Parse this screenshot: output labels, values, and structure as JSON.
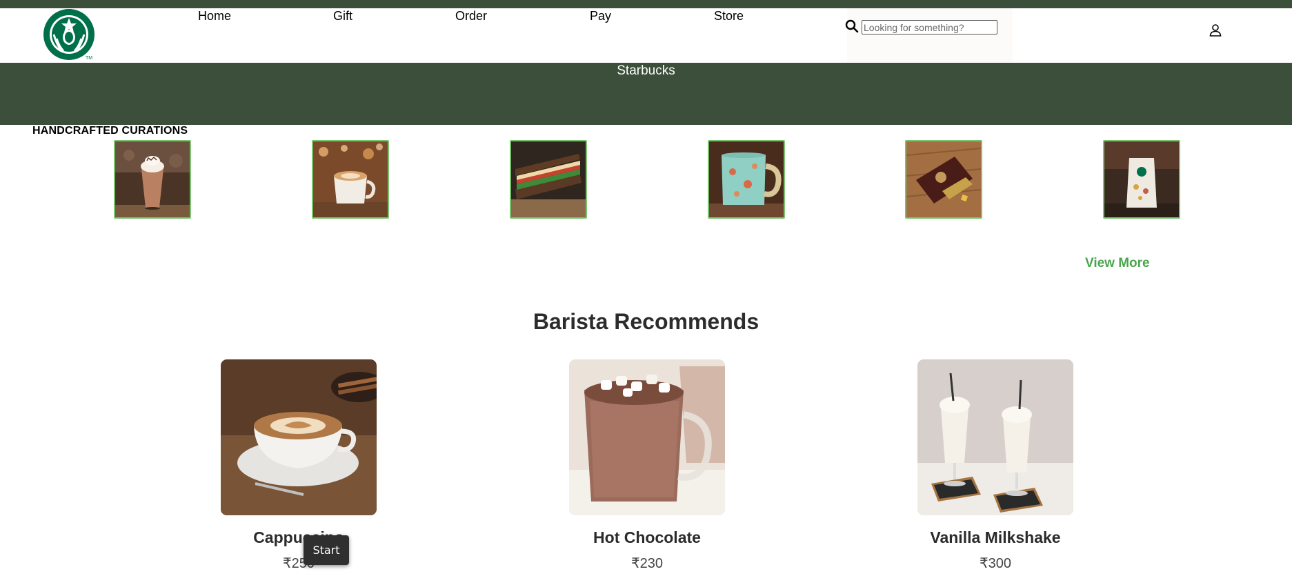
{
  "nav": {
    "items": [
      {
        "label": "Home"
      },
      {
        "label": "Gift"
      },
      {
        "label": "Order"
      },
      {
        "label": "Pay"
      },
      {
        "label": "Store"
      }
    ]
  },
  "search": {
    "placeholder": "Looking for something?",
    "value": ""
  },
  "icons": {
    "logo": "starbucks-siren-logo",
    "search": "search-icon",
    "user": "user-icon"
  },
  "banner": {
    "title": "Starbucks"
  },
  "curations": {
    "title": "HANDCRAFTED CURATIONS",
    "items": [
      {
        "image": "frappuccino-glass"
      },
      {
        "image": "latte-mug"
      },
      {
        "image": "sandwich"
      },
      {
        "image": "teal-mug"
      },
      {
        "image": "chocolate-box"
      },
      {
        "image": "coffee-bean-bag"
      }
    ],
    "view_more_label": "View More"
  },
  "barista": {
    "title": "Barista Recommends",
    "items": [
      {
        "name": "Cappuccino",
        "price": "₹250",
        "image": "cappuccino-cup"
      },
      {
        "name": "Hot Chocolate",
        "price": "₹230",
        "image": "hot-chocolate-mug"
      },
      {
        "name": "Vanilla Milkshake",
        "price": "₹300",
        "image": "milkshake-glasses"
      }
    ]
  },
  "taskbar_tooltip": {
    "label": "Start"
  },
  "colors": {
    "brand_dark_green": "#3b4f3a",
    "accent_green": "#4aa54d",
    "thumb_border": "#79c46c",
    "logo_green": "#00704a"
  }
}
